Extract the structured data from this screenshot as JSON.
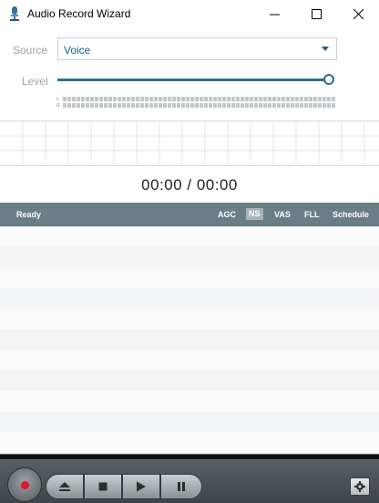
{
  "window": {
    "title": "Audio Record Wizard"
  },
  "source": {
    "label": "Source",
    "value": "Voice"
  },
  "level": {
    "label": "Level",
    "value_percent": 100,
    "meter_left_label": "L",
    "meter_right_label": "R"
  },
  "time": {
    "display": "00:00 / 00:00"
  },
  "status": {
    "text": "Ready",
    "flags": [
      {
        "label": "AGC",
        "active": false
      },
      {
        "label": "NS",
        "active": true
      },
      {
        "label": "VAS",
        "active": false
      },
      {
        "label": "FLL",
        "active": false
      },
      {
        "label": "Schedule",
        "active": false
      }
    ]
  },
  "icons": {
    "app": "microphone-icon",
    "minimize": "minimize-icon",
    "maximize": "maximize-icon",
    "close": "close-icon",
    "record": "record-icon",
    "eject": "eject-icon",
    "stop": "stop-icon",
    "play": "play-icon",
    "pause": "pause-icon",
    "settings": "gear-icon"
  },
  "colors": {
    "accent": "#2f6f92",
    "status_bar": "#6b7e86",
    "record": "#e3162a"
  }
}
